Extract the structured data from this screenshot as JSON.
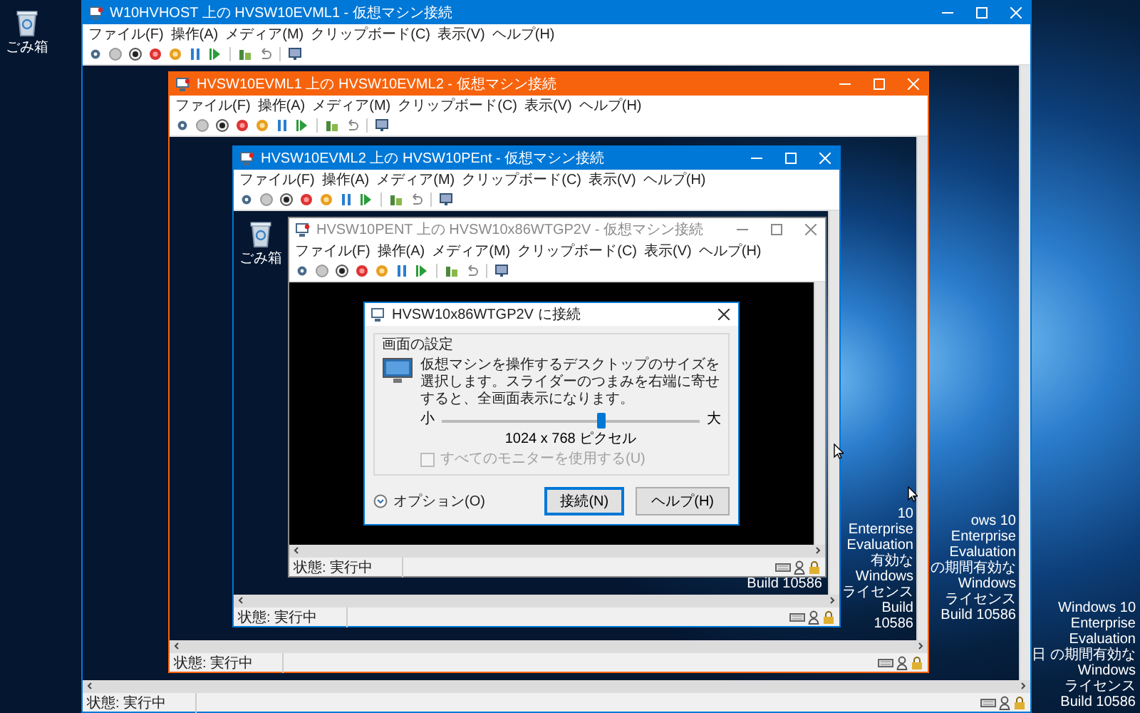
{
  "desktop": {
    "icons": [
      {
        "label": "ごみ箱"
      }
    ],
    "watermark": [
      "Windows 10 Enterprise Evaluation",
      "日 の期間有効な Windows ライセンス",
      "Build 10586"
    ]
  },
  "windows": [
    {
      "title": "W10HVHOST 上の HVSW10EVML1 - 仮想マシン接続",
      "color": "#0078d7",
      "menu": [
        "ファイル(F)",
        "操作(A)",
        "メディア(M)",
        "クリップボード(C)",
        "表示(V)",
        "ヘルプ(H)"
      ],
      "status": "状態: 実行中",
      "watermark": [
        "ows 10 Enterprise Evaluation",
        "の期間有効な Windows ライセンス",
        "Build 10586"
      ]
    },
    {
      "title": "HVSW10EVML1 上の HVSW10EVML2 - 仮想マシン接続",
      "color": "#f7630c",
      "menu": [
        "ファイル(F)",
        "操作(A)",
        "メディア(M)",
        "クリップボード(C)",
        "表示(V)",
        "ヘルプ(H)"
      ],
      "status": "状態: 実行中",
      "watermark": [
        "10 Enterprise Evaluation",
        "有効な Windows ライセンス",
        "Build 10586"
      ]
    },
    {
      "title": "HVSW10EVML2 上の HVSW10PEnt - 仮想マシン接続",
      "color": "#0078d7",
      "menu": [
        "ファイル(F)",
        "操作(A)",
        "メディア(M)",
        "クリップボード(C)",
        "表示(V)",
        "ヘルプ(H)"
      ],
      "status": "状態: 実行中",
      "icons": [
        {
          "label": "ごみ箱"
        }
      ],
      "watermark": [
        "Build 10586"
      ]
    },
    {
      "title": "HVSW10PENT 上の HVSW10x86WTGP2V - 仮想マシン接続",
      "color": "#ffffff",
      "menu": [
        "ファイル(F)",
        "操作(A)",
        "メディア(M)",
        "クリップボード(C)",
        "表示(V)",
        "ヘルプ(H)"
      ],
      "status": "状態: 実行中",
      "dialog": {
        "title": "HVSW10x86WTGP2V に接続",
        "group_title": "画面の設定",
        "description": "仮想マシンを操作するデスクトップのサイズを選択します。スライダーのつまみを右端に寄せすると、全画面表示になります。",
        "slider": {
          "min_label": "小",
          "max_label": "大",
          "level": 0.62
        },
        "resolution": "1024 x 768 ピクセル",
        "monitor_checkbox": {
          "label": "すべてのモニターを使用する(U)",
          "checked": false,
          "disabled": true
        },
        "options_label": "オプション(O)",
        "buttons": [
          {
            "label": "接続(N)",
            "default": true
          },
          {
            "label": "ヘルプ(H)",
            "default": false
          }
        ]
      }
    }
  ]
}
